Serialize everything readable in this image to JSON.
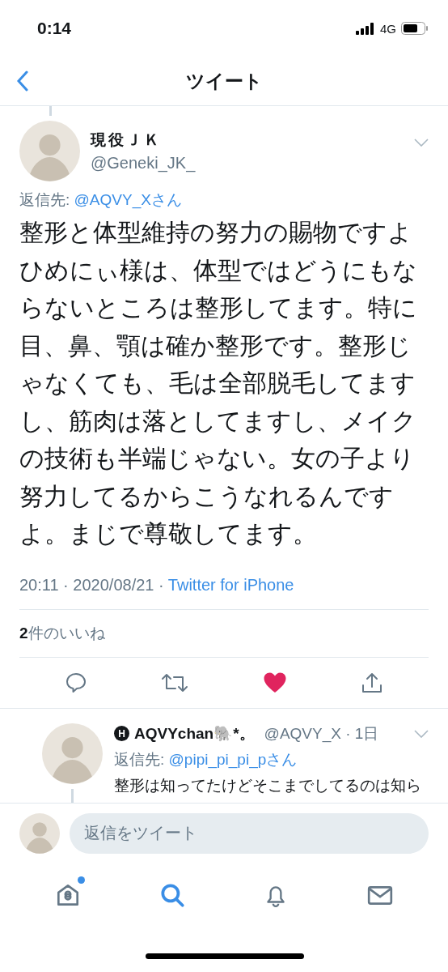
{
  "status_bar": {
    "time": "0:14",
    "network": "4G"
  },
  "header": {
    "title": "ツイート"
  },
  "tweet": {
    "author_name": "現役ＪＫ",
    "handle": "@Geneki_JK_",
    "reply_label": "返信先: ",
    "reply_to": "@AQVY_Xさん",
    "body_lines": [
      "整形と体型維持の努力の賜物ですよ",
      "ひめにぃ様は、体型ではどうにもならないところは整形してます。特に目、鼻、顎は確か整形です。整形じゃなくても、毛は全部脱毛してますし、筋肉は落としてますし、メイクの技術も半端じゃない。女の子より努力してるからこうなれるんですよ。まじで尊敬してます。"
    ],
    "time": "20:11 · 2020/08/21 · ",
    "source": "Twitter for iPhone",
    "likes": "**2**件のいいね",
    "liked": true
  },
  "reply": {
    "badge": "H",
    "author_name": "AQVYchan🐘*。",
    "handle": "@AQVY_X",
    "age": "· 1日",
    "reply_label": "返信先: ",
    "reply_to": "@pipi_pi_pi_pさん",
    "body": "整形は知ってたけどそこまでしてるのは知ら"
  },
  "compose": {
    "placeholder": "返信をツイート"
  },
  "tabs": [
    {
      "kind": "home",
      "selected": false,
      "has_new": true
    },
    {
      "kind": "search",
      "selected": true,
      "has_new": false
    },
    {
      "kind": "notifications",
      "selected": false,
      "has_new": false
    },
    {
      "kind": "messages",
      "selected": false,
      "has_new": false
    }
  ]
}
